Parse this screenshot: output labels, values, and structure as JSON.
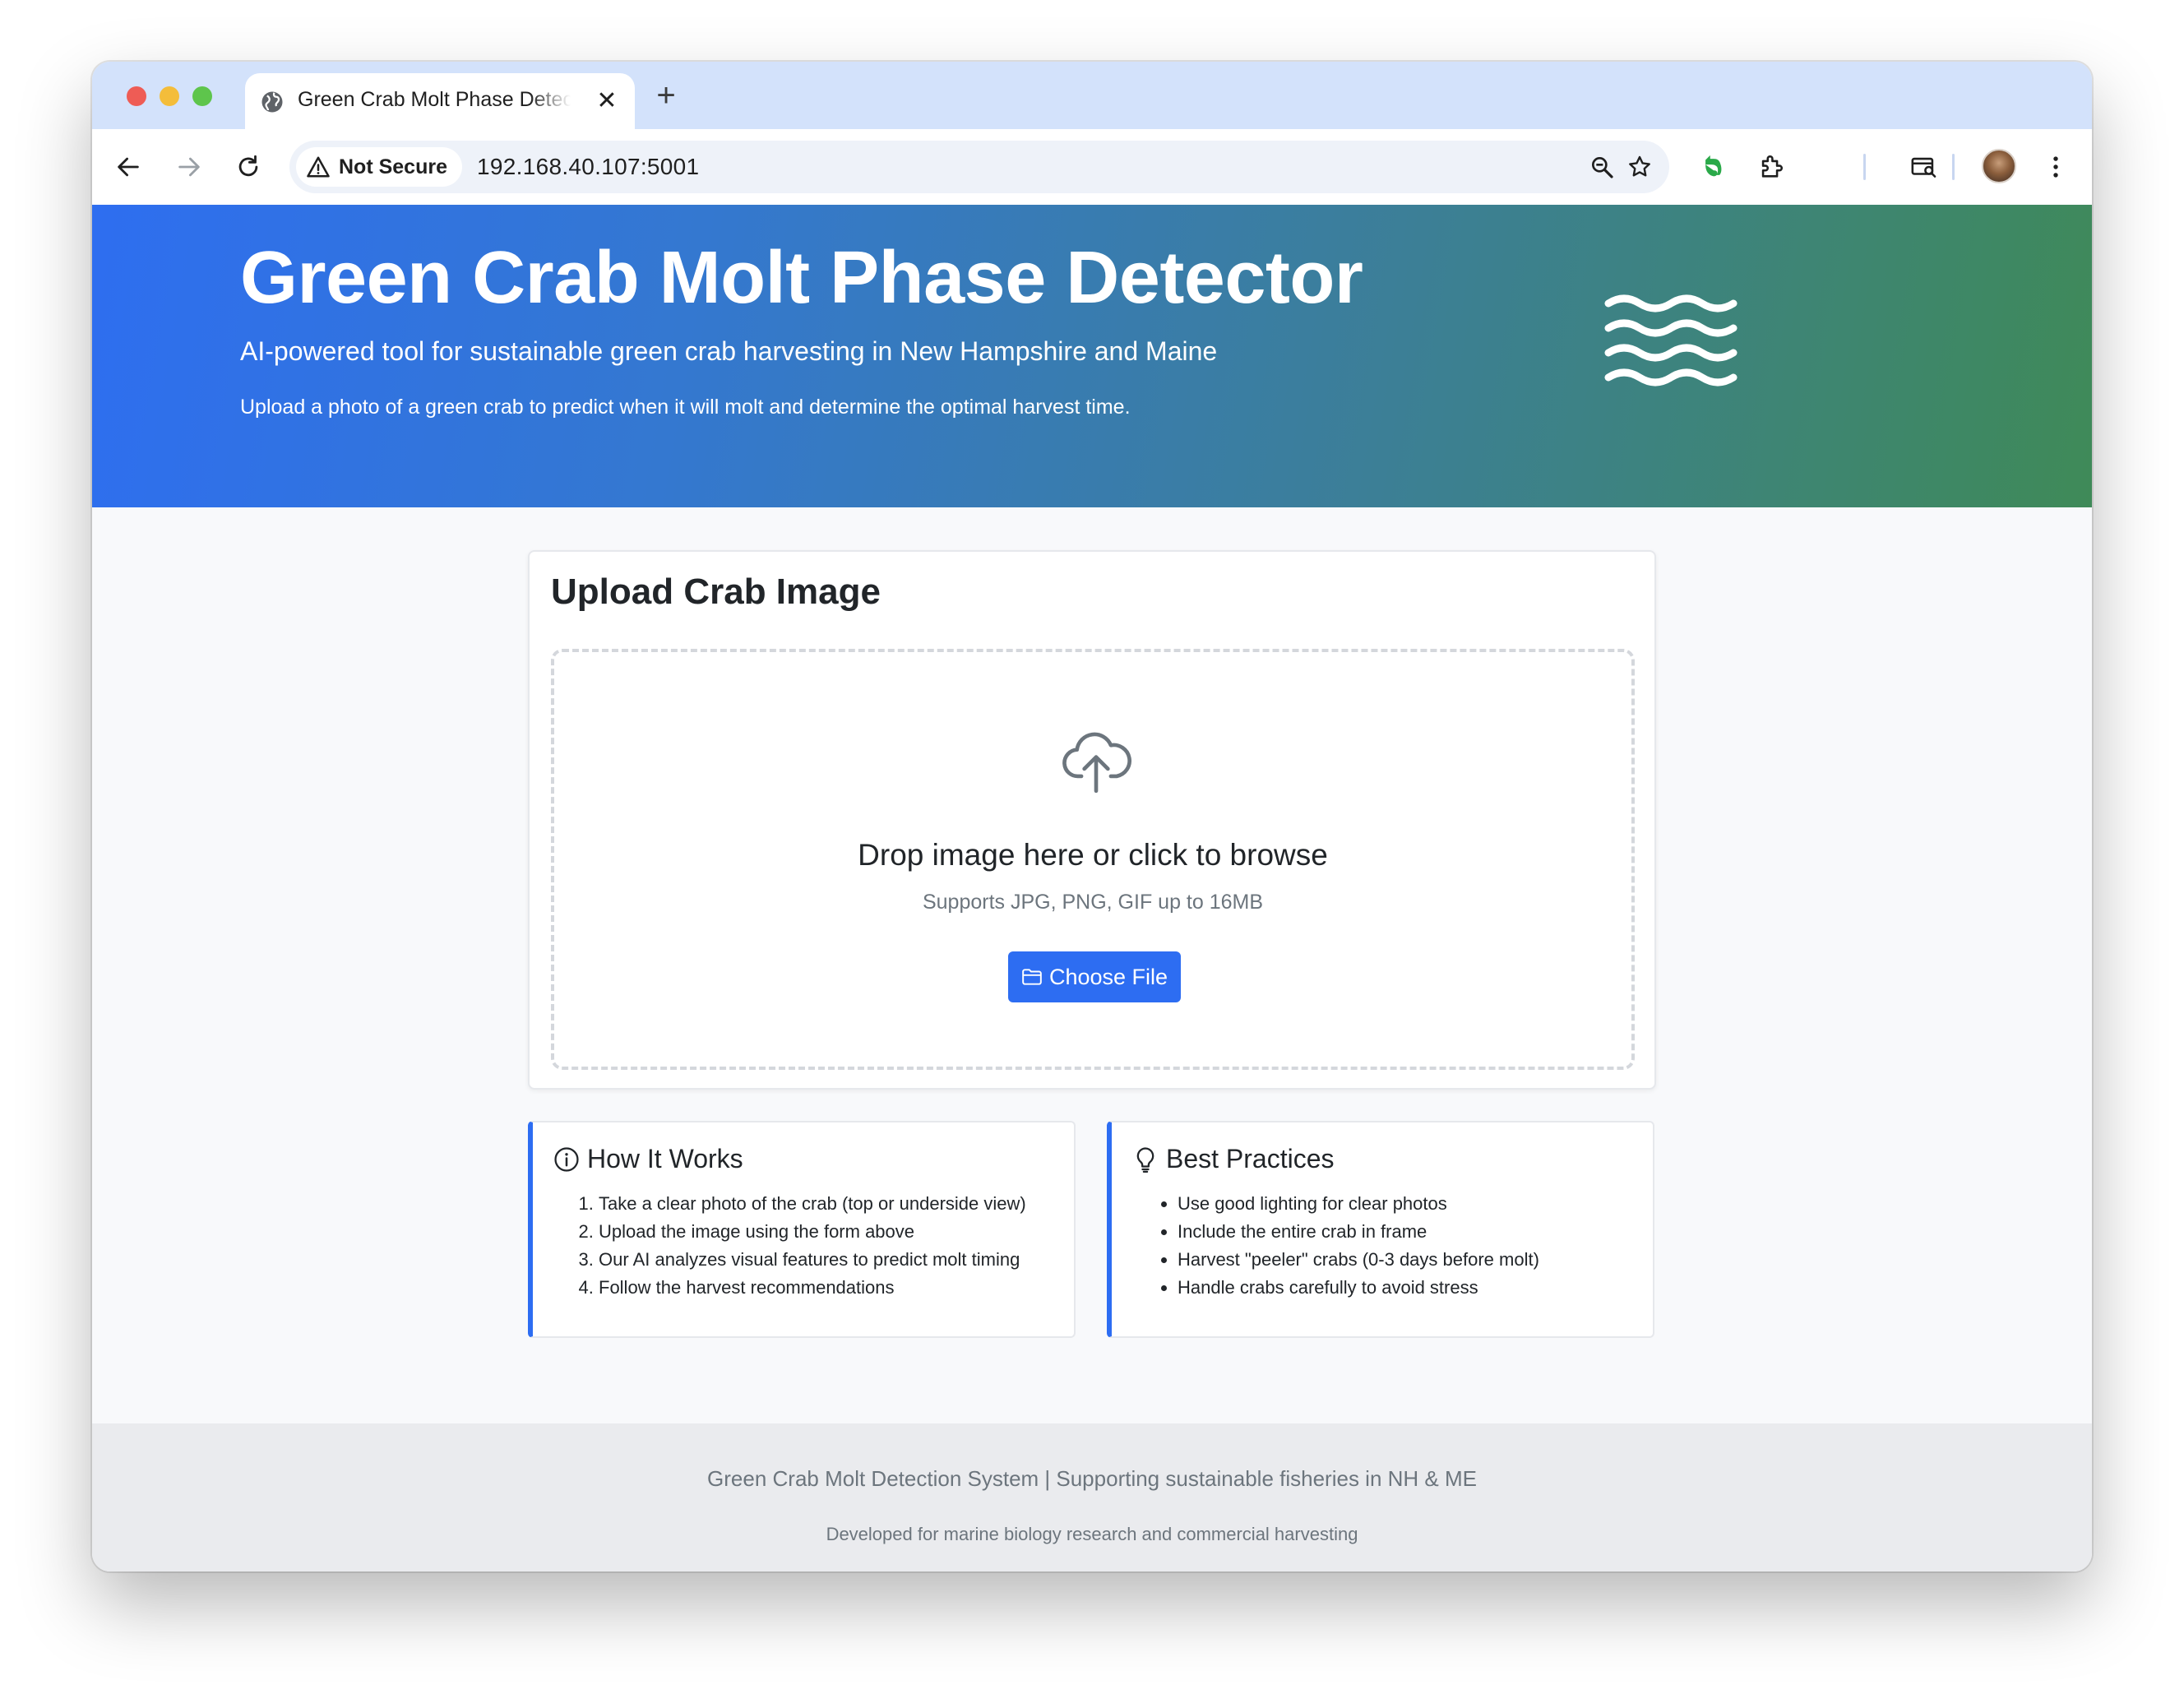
{
  "browser": {
    "tab": {
      "title": "Green Crab Molt Phase Detector",
      "icon": "globe-icon",
      "close_glyph": "✕"
    },
    "new_tab_glyph": "+",
    "security_label": "Not Secure",
    "url": "192.168.40.107:5001",
    "toolbar_icons": [
      "back-arrow-icon",
      "forward-arrow-icon",
      "reload-icon",
      "zoom-icon",
      "bookmark-star-icon",
      "evernote-extension-icon",
      "extensions-puzzle-icon",
      "tab-search-icon",
      "profile-avatar",
      "kebab-menu-icon"
    ]
  },
  "hero": {
    "title": "Green Crab Molt Phase Detector",
    "subtitle": "AI-powered tool for sustainable green crab harvesting in New Hampshire and Maine",
    "description": "Upload a photo of a green crab to predict when it will molt and determine the optimal harvest time.",
    "icon": "waves-icon"
  },
  "upload": {
    "title": "Upload Crab Image",
    "drop_title": "Drop image here or click to browse",
    "hint": "Supports JPG, PNG, GIF up to 16MB",
    "button_label": "Choose File",
    "icons": [
      "cloud-upload-icon",
      "folder-icon"
    ]
  },
  "how_it_works": {
    "title": "How It Works",
    "icon": "info-circle-icon",
    "steps": [
      "Take a clear photo of the crab (top or underside view)",
      "Upload the image using the form above",
      "Our AI analyzes visual features to predict molt timing",
      "Follow the harvest recommendations"
    ]
  },
  "best_practices": {
    "title": "Best Practices",
    "icon": "lightbulb-icon",
    "items": [
      "Use good lighting for clear photos",
      "Include the entire crab in frame",
      "Harvest \"peeler\" crabs (0-3 days before molt)",
      "Handle crabs carefully to avoid stress"
    ]
  },
  "footer": {
    "main": "Green Crab Molt Detection System | Supporting sustainable fisheries in NH & ME",
    "sub": "Developed for marine biology research and commercial harvesting"
  },
  "colors": {
    "accent": "#2d6df2",
    "hero_gradient_start": "#2e6ef0",
    "hero_gradient_end": "#3f8a58",
    "tabstrip": "#d3e2fb",
    "page_background": "#f8f9fb",
    "footer_background": "#eaebee"
  }
}
